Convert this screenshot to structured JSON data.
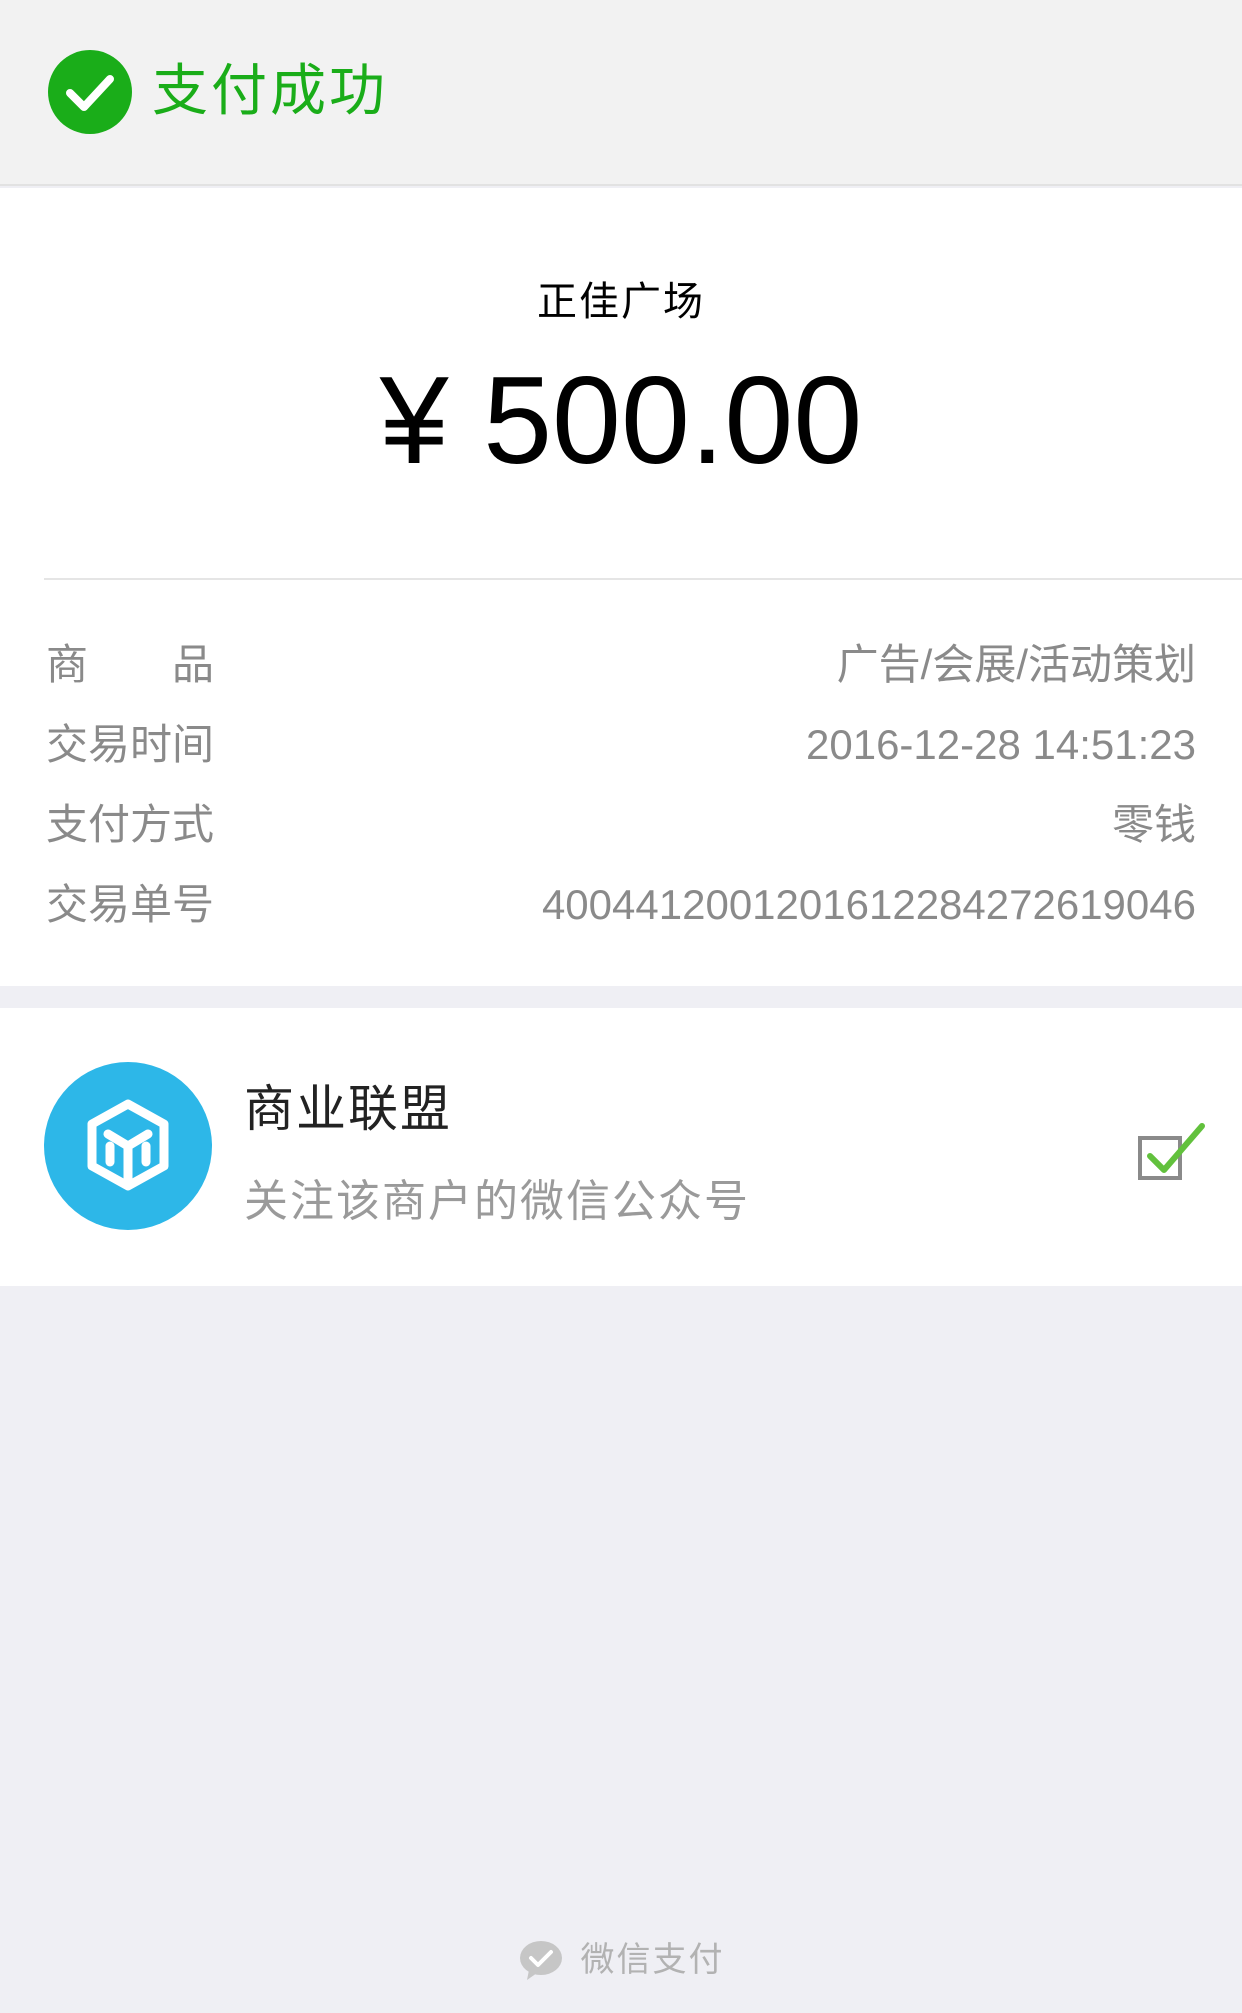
{
  "header": {
    "status_text": "支付成功",
    "icon": "check-circle-icon",
    "accent_color": "#1aad19"
  },
  "receipt": {
    "merchant_name": "正佳广场",
    "amount": "¥ 500.00",
    "details": [
      {
        "label": "商　　品",
        "value": "广告/会展/活动策划"
      },
      {
        "label": "交易时间",
        "value": "2016-12-28 14:51:23"
      },
      {
        "label": "支付方式",
        "value": "零钱"
      },
      {
        "label": "交易单号",
        "value": "4004412001201612284272619046"
      }
    ]
  },
  "follow": {
    "title": "商业联盟",
    "subtitle": "关注该商户的微信公众号",
    "logo_icon": "cube-logo-icon",
    "logo_color": "#2db7e8",
    "checked": true
  },
  "footer": {
    "text": "微信支付",
    "icon": "wechat-icon"
  }
}
